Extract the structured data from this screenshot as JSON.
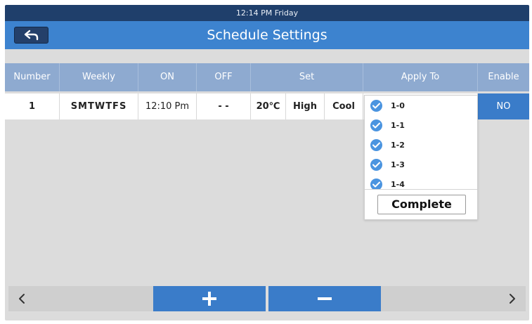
{
  "status": {
    "time": "12:14 PM Friday"
  },
  "header": {
    "title": "Schedule Settings"
  },
  "table": {
    "columns": [
      {
        "key": "number",
        "label": "Number",
        "width": 78
      },
      {
        "key": "weekly",
        "label": "Weekly",
        "width": 112
      },
      {
        "key": "on",
        "label": "ON",
        "width": 83
      },
      {
        "key": "off",
        "label": "OFF",
        "width": 77
      },
      {
        "key": "set",
        "label": "Set",
        "width": 160
      },
      {
        "key": "apply",
        "label": "Apply To",
        "width": 163
      },
      {
        "key": "enable",
        "label": "Enable",
        "width": 73
      }
    ],
    "row": {
      "number": "1",
      "weekly": "SMTWTFS",
      "on": "12:10 Pm",
      "off": "- -",
      "temp": "20℃",
      "fan": "High",
      "mode": "Cool",
      "enable": "NO"
    }
  },
  "apply_popup": {
    "items": [
      "1-0",
      "1-1",
      "1-2",
      "1-3",
      "1-4"
    ],
    "complete_label": "Complete"
  },
  "colors": {
    "title_bar": "#3d83cf",
    "status_bar": "#1f3f6b",
    "accent": "#3a7cc9",
    "header_row": "#8eaad0"
  }
}
